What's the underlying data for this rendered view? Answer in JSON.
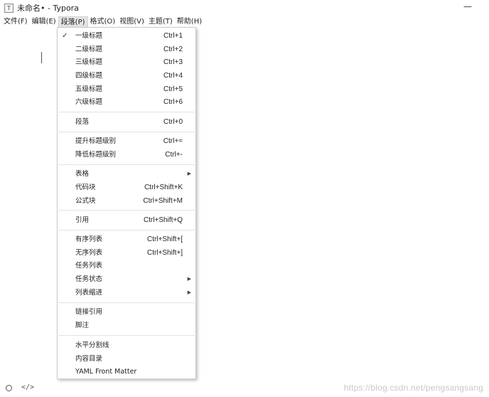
{
  "window": {
    "icon_glyph": "T",
    "title": "未命名• - Typora",
    "minimize_glyph": "—"
  },
  "menubar": [
    {
      "label": "文件(F)",
      "name": "menu-file"
    },
    {
      "label": "编辑(E)",
      "name": "menu-edit"
    },
    {
      "label": "段落(P)",
      "name": "menu-paragraph"
    },
    {
      "label": "格式(O)",
      "name": "menu-format"
    },
    {
      "label": "视图(V)",
      "name": "menu-view"
    },
    {
      "label": "主题(T)",
      "name": "menu-theme"
    },
    {
      "label": "帮助(H)",
      "name": "menu-help"
    }
  ],
  "paragraph_menu": {
    "check_glyph": "✓",
    "submenu_glyph": "▶",
    "items": [
      {
        "label": "一级标题",
        "shortcut": "Ctrl+1"
      },
      {
        "label": "二级标题",
        "shortcut": "Ctrl+2"
      },
      {
        "label": "三级标题",
        "shortcut": "Ctrl+3"
      },
      {
        "label": "四级标题",
        "shortcut": "Ctrl+4"
      },
      {
        "label": "五级标题",
        "shortcut": "Ctrl+5"
      },
      {
        "label": "六级标题",
        "shortcut": "Ctrl+6"
      },
      {
        "label": "段落",
        "shortcut": "Ctrl+0"
      },
      {
        "label": "提升标题级别",
        "shortcut": "Ctrl+="
      },
      {
        "label": "降低标题级别",
        "shortcut": "Ctrl+-"
      },
      {
        "label": "表格",
        "shortcut": ""
      },
      {
        "label": "代码块",
        "shortcut": "Ctrl+Shift+K"
      },
      {
        "label": "公式块",
        "shortcut": "Ctrl+Shift+M"
      },
      {
        "label": "引用",
        "shortcut": "Ctrl+Shift+Q"
      },
      {
        "label": "有序列表",
        "shortcut": "Ctrl+Shift+["
      },
      {
        "label": "无序列表",
        "shortcut": "Ctrl+Shift+]"
      },
      {
        "label": "任务列表",
        "shortcut": ""
      },
      {
        "label": "任务状态",
        "shortcut": ""
      },
      {
        "label": "列表缩进",
        "shortcut": ""
      },
      {
        "label": "链接引用",
        "shortcut": ""
      },
      {
        "label": "脚注",
        "shortcut": ""
      },
      {
        "label": "水平分割线",
        "shortcut": ""
      },
      {
        "label": "内容目录",
        "shortcut": ""
      },
      {
        "label": "YAML Front Matter",
        "shortcut": ""
      }
    ]
  },
  "statusbar": {
    "source_code_glyph": "</>",
    "watermark": "https://blog.csdn.net/pengsangsang"
  }
}
